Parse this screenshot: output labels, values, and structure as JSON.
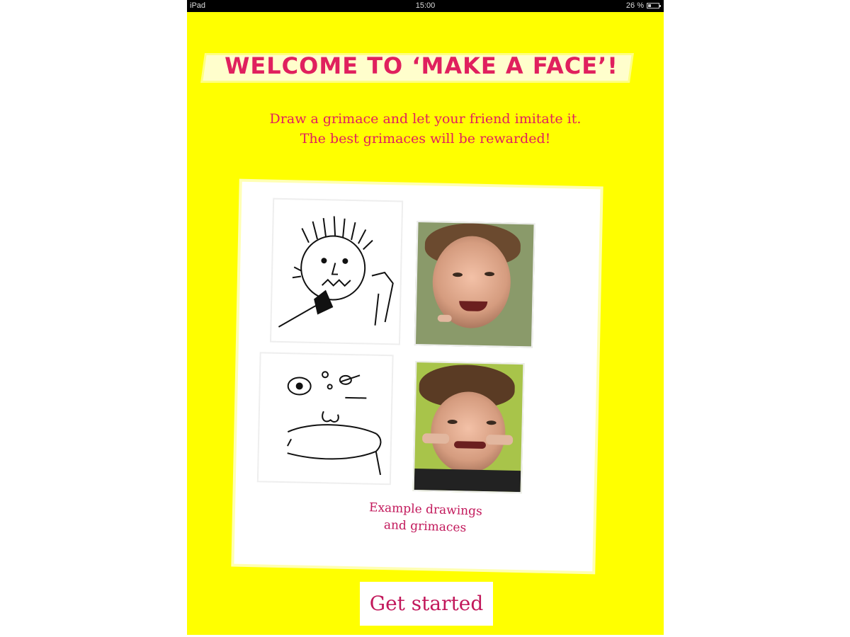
{
  "status_bar": {
    "device": "iPad",
    "time": "15:00",
    "battery_percent": "26 %",
    "battery_level": 0.26
  },
  "title": "WELCOME TO ‘MAKE A FACE’!",
  "subtitle": {
    "line1": "Draw a grimace and let your friend imitate it.",
    "line2": "The best grimaces will be rewarded!"
  },
  "examples": {
    "caption_line1": "Example drawings",
    "caption_line2": "and grimaces"
  },
  "button": {
    "label": "Get started"
  },
  "colors": {
    "background": "#ffff00",
    "accent": "#e0205e",
    "button_text": "#c2185b"
  }
}
